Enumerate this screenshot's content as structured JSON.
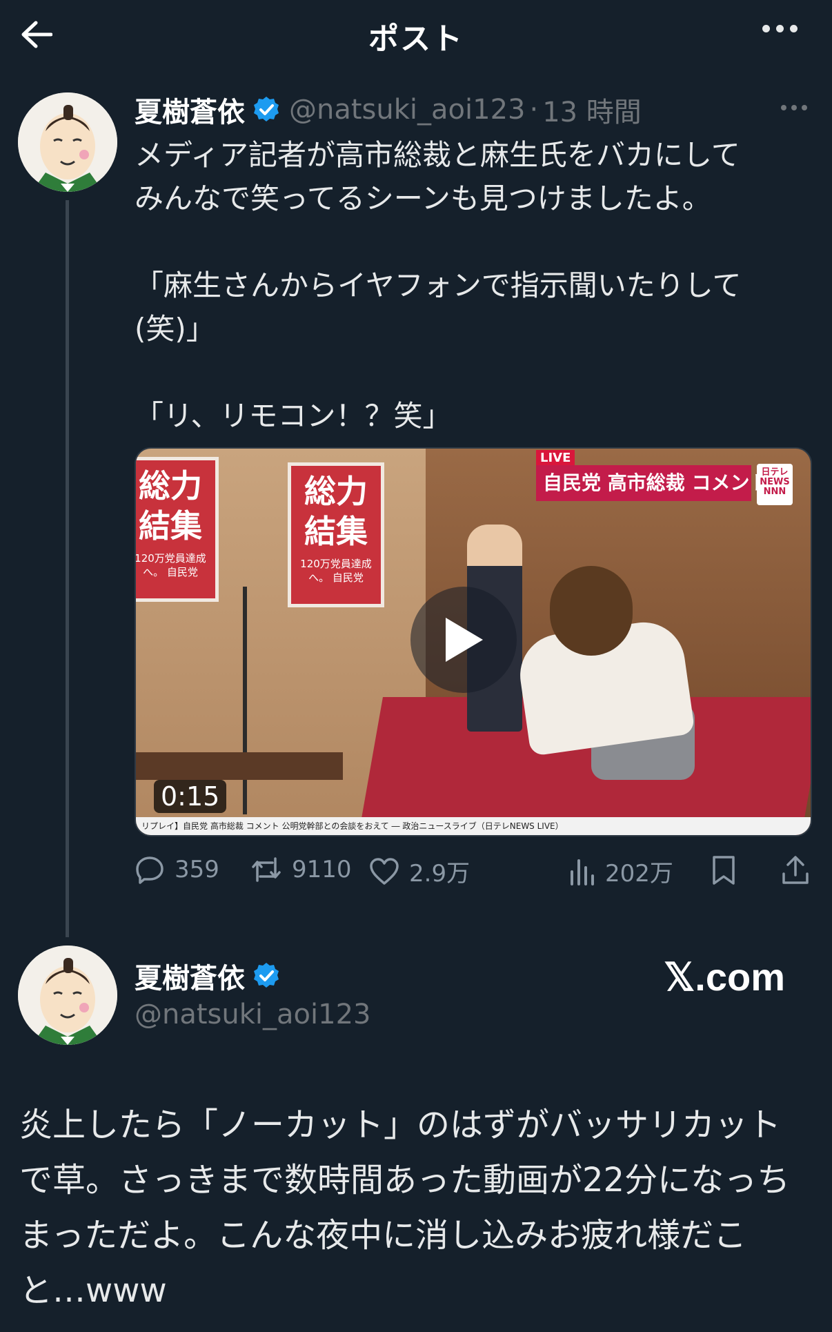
{
  "header": {
    "title": "ポスト",
    "back_icon": "arrow-left-icon",
    "more_icon": "more-horizontal-icon"
  },
  "post": {
    "author_name": "夏樹蒼依",
    "handle": "@natsuki_aoi123",
    "separator": "·",
    "time": "13 時間",
    "text_lines": [
      "メディア記者が高市総裁と麻生氏をバカにして",
      "みんなで笑ってるシーンも見つけましたよ。",
      "",
      "「麻生さんからイヤフォンで指示聞いたりして",
      "(笑)」",
      "",
      "「リ、リモコン！？笑」"
    ],
    "video": {
      "duration": "0:15",
      "live_label": "LIVE",
      "banner": "自民党 高市総裁 コメント",
      "channel": "日テレ NEWS NNN",
      "poster_text": "総力 結集",
      "poster_sub": "120万党員達成へ。 自民党",
      "ticker": "リプレイ】自民党 高市総裁 コメント 公明党幹部との会談をおえて ― 政治ニュースライブ（日テレNEWS LIVE）"
    },
    "stats": {
      "replies": "359",
      "reposts": "9110",
      "likes": "2.9万",
      "views": "202万"
    }
  },
  "card": {
    "author_name": "夏樹蒼依",
    "handle": "@natsuki_aoi123",
    "site": "𝕏.com",
    "text": "炎上したら「ノーカット」のはずがバッサリカットで草。さっきまで数時間あった動画が22分になっちまっただよ。こんな夜中に消し込みお疲れ様だこと…www"
  },
  "colors": {
    "background": "#15202b",
    "verified": "#1d9bf0",
    "muted": "#71767b",
    "text": "#e7e9ea"
  }
}
